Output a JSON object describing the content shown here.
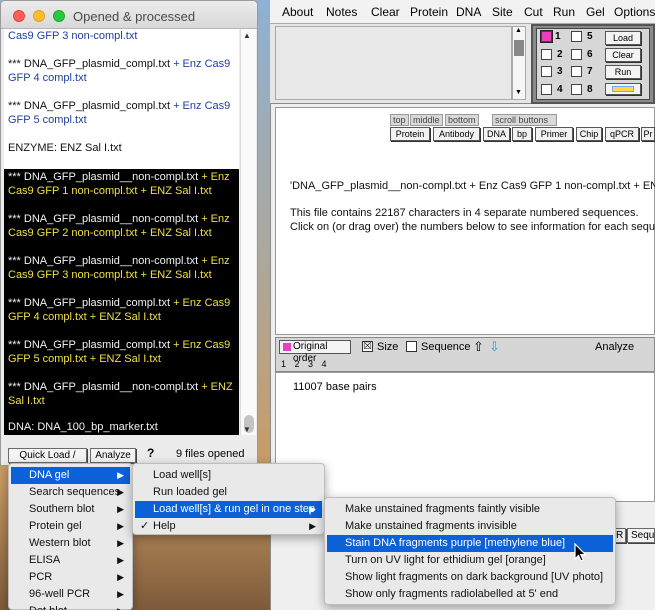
{
  "left_window": {
    "title": "Opened & processed",
    "file_blocks": [
      {
        "style": "white",
        "lines": [
          {
            "t": "Cas9 GFP 3 non-compl.txt",
            "c": "blue"
          }
        ]
      },
      {
        "style": "white",
        "lines": [
          {
            "t": "*** DNA_GFP_plasmid_compl.txt",
            "c": "dark",
            "t2": " + Enz Cas9",
            "c2": "blue"
          },
          {
            "t": "GFP 4 compl.txt",
            "c": "blue"
          }
        ]
      },
      {
        "style": "white",
        "lines": [
          {
            "t": "*** DNA_GFP_plasmid_compl.txt",
            "c": "dark",
            "t2": " + Enz Cas9",
            "c2": "blue"
          },
          {
            "t": "GFP 5 compl.txt",
            "c": "blue"
          }
        ]
      },
      {
        "style": "white",
        "lines": [
          {
            "t": "ENZYME: ENZ Sal I.txt",
            "c": "dark"
          }
        ]
      },
      {
        "style": "black",
        "lines": [
          {
            "t": "*** DNA_GFP_plasmid__non-compl.txt",
            "c": "white",
            "t2": " + Enz",
            "c2": "yellow"
          },
          {
            "t": "Cas9 GFP 1 non-compl.txt + ENZ Sal I.txt",
            "c": "yellow"
          }
        ]
      },
      {
        "style": "black",
        "lines": [
          {
            "t": "*** DNA_GFP_plasmid__non-compl.txt",
            "c": "white",
            "t2": " + Enz",
            "c2": "yellow"
          },
          {
            "t": "Cas9 GFP 2 non-compl.txt + ENZ Sal I.txt",
            "c": "yellow"
          }
        ]
      },
      {
        "style": "black",
        "lines": [
          {
            "t": "*** DNA_GFP_plasmid__non-compl.txt",
            "c": "white",
            "t2": " + Enz",
            "c2": "yellow"
          },
          {
            "t": "Cas9 GFP 3 non-compl.txt + ENZ Sal I.txt",
            "c": "yellow"
          }
        ]
      },
      {
        "style": "black",
        "lines": [
          {
            "t": "*** DNA_GFP_plasmid_compl.txt",
            "c": "white",
            "t2": " + Enz Cas9",
            "c2": "yellow"
          },
          {
            "t": "GFP 4 compl.txt + ENZ Sal I.txt",
            "c": "yellow"
          }
        ]
      },
      {
        "style": "black",
        "lines": [
          {
            "t": "*** DNA_GFP_plasmid_compl.txt",
            "c": "white",
            "t2": " + Enz Cas9",
            "c2": "yellow"
          },
          {
            "t": "GFP 5 compl.txt + ENZ Sal I.txt",
            "c": "yellow"
          }
        ]
      },
      {
        "style": "black",
        "lines": [
          {
            "t": "*** DNA_GFP_plasmid__non-compl.txt",
            "c": "white",
            "t2": " + ENZ",
            "c2": "yellow"
          },
          {
            "t": "Sal I.txt",
            "c": "yellow"
          }
        ]
      },
      {
        "style": "black",
        "lines": [
          {
            "t": "DNA: DNA_100_bp_marker.txt",
            "c": "white"
          }
        ]
      }
    ],
    "quick_load_label": "Quick Load / Run",
    "analyze_label": "Analyze",
    "help_label": "?",
    "files_opened": "9   files opened"
  },
  "menubar": [
    "About",
    "Notes",
    "Clear",
    "Protein",
    "DNA",
    "Site",
    "Cut",
    "Run",
    "Gel",
    "Options"
  ],
  "lanes": {
    "numbers": [
      "1",
      "5",
      "2",
      "6",
      "3",
      "7",
      "4",
      "8"
    ],
    "load_label": "Load",
    "clear_label": "Clear",
    "run_label": "Run"
  },
  "main_pane": {
    "tabs_top": [
      "top",
      "middle",
      "bottom"
    ],
    "scroll_buttons_label": "scroll buttons",
    "tools": [
      "Protein",
      "Antibody",
      "DNA",
      "bp",
      "Primer",
      "Chip",
      "qPCR",
      "Pr"
    ],
    "heading": "'DNA_GFP_plasmid__non-compl.txt + Enz Cas9 GFP 1 non-compl.txt + ENZ S",
    "info_line1": "This file contains 22187 characters in 4 separate numbered sequences.",
    "info_line2": "Click on (or drag over) the numbers below to see information for each sequence"
  },
  "options_bar": {
    "original_order": "Original order",
    "size_label": "Size",
    "size_checked": "☒",
    "sequence_label": "Sequence",
    "analyze_label": "Analyze",
    "seq_numbers": "1 2 3 4"
  },
  "second_pane": {
    "base_pairs": "11007 base pairs"
  },
  "partial_buttons": [
    "R",
    "Seque"
  ],
  "menus": {
    "main": [
      {
        "label": "DNA gel",
        "arrow": true,
        "selected": true
      },
      {
        "label": "Search sequences",
        "arrow": true
      },
      {
        "label": "Southern blot",
        "arrow": true
      },
      {
        "label": "Protein gel",
        "arrow": true
      },
      {
        "label": "Western blot",
        "arrow": true
      },
      {
        "label": "ELISA",
        "arrow": true
      },
      {
        "label": "PCR",
        "arrow": true
      },
      {
        "label": "96-well PCR",
        "arrow": true
      },
      {
        "label": "Dot blot",
        "arrow": true
      }
    ],
    "dna_gel": [
      {
        "label": "Load  well[s]",
        "arrow": false
      },
      {
        "label": "Run loaded gel",
        "arrow": false
      },
      {
        "label": "Load well[s] & run gel in one step",
        "arrow": true,
        "selected": true
      },
      {
        "label": "Help",
        "arrow": true,
        "check": "✓"
      }
    ],
    "load_run": [
      {
        "label": "Make unstained fragments faintly visible"
      },
      {
        "label": "Make unstained fragments invisible"
      },
      {
        "label": "Stain DNA fragments purple [methylene blue]",
        "selected": true
      },
      {
        "label": "Turn on UV light for ethidium gel [orange]"
      },
      {
        "label": "Show light fragments on dark background  [UV photo]"
      },
      {
        "label": "Show only fragments radiolabelled at 5' end"
      }
    ]
  },
  "colors": {
    "menu_highlight": "#0b61d8",
    "yellow_text": "#f0e042",
    "blue_text": "#1f3e9e",
    "lane_pink": "#e63fc0"
  },
  "icons": [
    "close-icon",
    "minimize-icon",
    "maximize-icon",
    "submenu-arrow-icon",
    "checkmark-icon",
    "up-arrow-icon",
    "down-arrow-icon",
    "pointer-cursor-icon"
  ]
}
